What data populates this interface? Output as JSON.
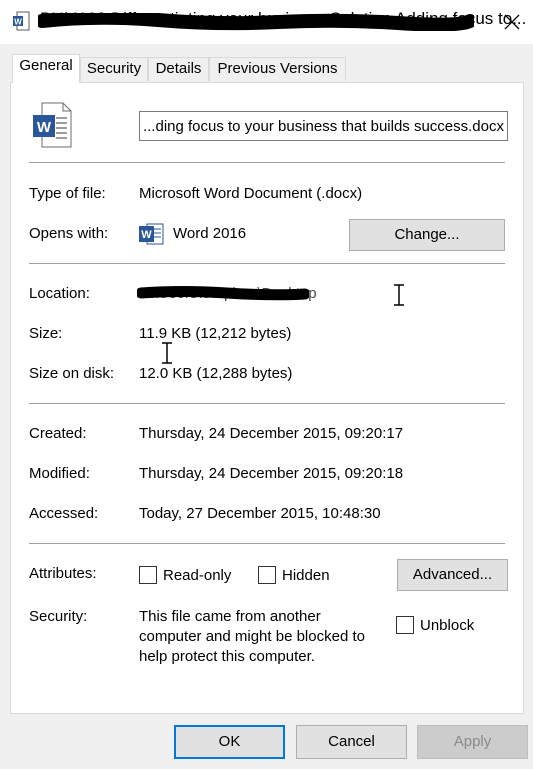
{
  "window": {
    "title": "BUM183 Differentiating your business Solution Adding focus to...",
    "title_redacted": true,
    "close_icon": "close-icon"
  },
  "tabs": [
    {
      "label": "General",
      "active": true
    },
    {
      "label": "Security",
      "active": false
    },
    {
      "label": "Details",
      "active": false
    },
    {
      "label": "Previous Versions",
      "active": false
    }
  ],
  "general": {
    "file_icon": "word-document-icon",
    "filename": "...ding focus to your business that builds success.docx",
    "type_of_file": {
      "label": "Type of file:",
      "value": "Microsoft Word Document (.docx)"
    },
    "opens_with": {
      "label": "Opens with:",
      "app_icon": "word-icon",
      "value": "Word 2016",
      "change_button": "Change..."
    },
    "location": {
      "label": "Location:",
      "value": "C:\\Users\\Stephen\\Desktop",
      "redacted": true
    },
    "size": {
      "label": "Size:",
      "value": "11.9 KB (12,212 bytes)"
    },
    "size_on_disk": {
      "label": "Size on disk:",
      "value": "12.0 KB (12,288 bytes)"
    },
    "created": {
      "label": "Created:",
      "value": "Thursday, 24 December 2015, 09:20:17"
    },
    "modified": {
      "label": "Modified:",
      "value": "Thursday, 24 December 2015, 09:20:18"
    },
    "accessed": {
      "label": "Accessed:",
      "value": "Today, 27 December 2015, 10:48:30"
    },
    "attributes": {
      "label": "Attributes:",
      "read_only": {
        "label": "Read-only",
        "checked": false
      },
      "hidden": {
        "label": "Hidden",
        "checked": false
      },
      "advanced_button": "Advanced..."
    },
    "security": {
      "label": "Security:",
      "lines": [
        "This file came from another",
        "computer and might be blocked to",
        "help protect this computer."
      ],
      "unblock": {
        "label": "Unblock",
        "checked": false
      }
    }
  },
  "footer": {
    "ok": "OK",
    "cancel": "Cancel",
    "apply": "Apply"
  },
  "colors": {
    "word_blue": "#2b579a",
    "focus_border": "#0078d7",
    "redaction": "#000000"
  }
}
